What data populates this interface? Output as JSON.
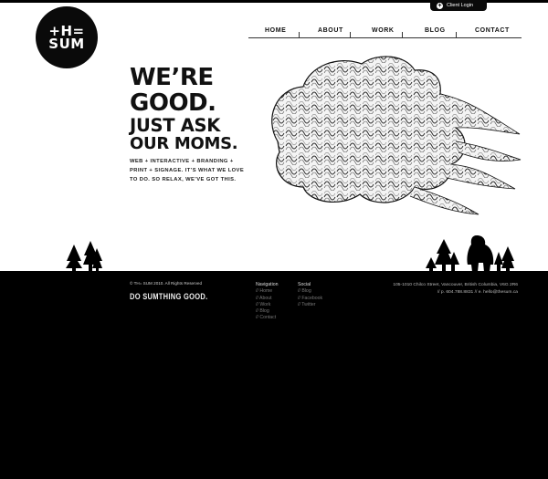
{
  "header": {
    "client_login_label": "Client Login",
    "logo_text": "+H=\nSUM"
  },
  "nav": {
    "items": [
      "HOME",
      "ABOUT",
      "WORK",
      "BLOG",
      "CONTACT"
    ]
  },
  "hero": {
    "headline_1": "WE’RE",
    "headline_2": "GOOD.",
    "headline_3": "JUST ASK",
    "headline_4": "OUR MOMS.",
    "tagline_1": "WEB + INTERACTIVE + BRANDING +",
    "tagline_2": "PRINT + SIGNAGE. IT’S WHAT WE LOVE",
    "tagline_3": "TO DO. SO RELAX, WE’VE GOT THIS."
  },
  "footer": {
    "copyright": "© TH= SUM 2010. All Rights Reserved",
    "slogan": "DO SUMTHING GOOD.",
    "navigation_title": "Navigation",
    "navigation_links": [
      "// Home",
      "// About",
      "// Work",
      "// Blog",
      "// Contact"
    ],
    "social_title": "Social",
    "social_links": [
      "// Blog",
      "// Facebook",
      "// Twitter"
    ],
    "address": "105-1010 Chilco Street, Vancouver, British Columbia, V6G 2R6",
    "contact": "// p. 604.788.8831 // e. hello@thesum.ca"
  },
  "colors": {
    "background": "#ffffff",
    "footer_bg": "#000000",
    "text": "#111111",
    "footer_link": "#777777"
  },
  "icons": [
    "plus-circle-icon",
    "logo-mark",
    "cloud-illustration",
    "pine-tree-icon",
    "bigfoot-silhouette"
  ]
}
